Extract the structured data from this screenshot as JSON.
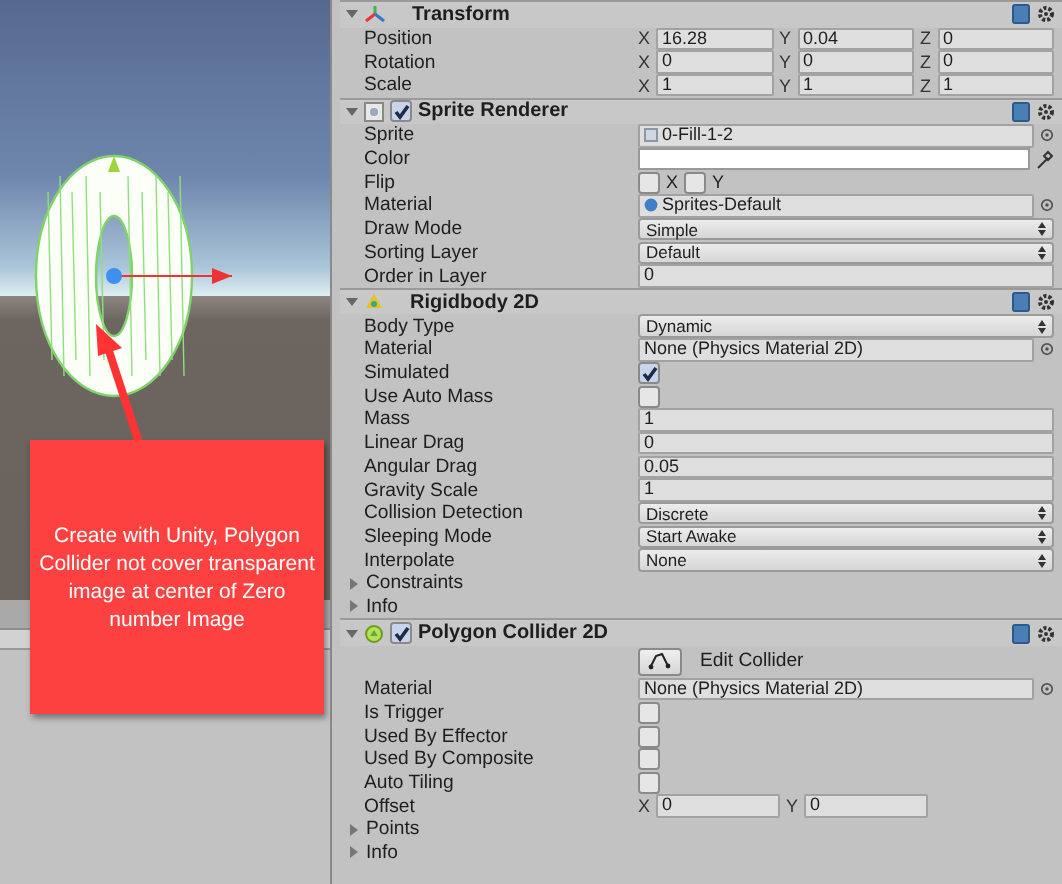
{
  "scene": {
    "annotation": "Create with Unity, Polygon Collider not cover transparent image at center of Zero number Image"
  },
  "components": [
    {
      "kind": "transform",
      "title": "Transform",
      "expanded": true,
      "rows": [
        {
          "kind": "vector",
          "label": "Position",
          "axes": [
            {
              "axis": "X",
              "value": "16.28"
            },
            {
              "axis": "Y",
              "value": "0.04"
            },
            {
              "axis": "Z",
              "value": "0"
            }
          ]
        },
        {
          "kind": "vector",
          "label": "Rotation",
          "axes": [
            {
              "axis": "X",
              "value": "0"
            },
            {
              "axis": "Y",
              "value": "0"
            },
            {
              "axis": "Z",
              "value": "0"
            }
          ]
        },
        {
          "kind": "vector",
          "label": "Scale",
          "axes": [
            {
              "axis": "X",
              "value": "1"
            },
            {
              "axis": "Y",
              "value": "1"
            },
            {
              "axis": "Z",
              "value": "1"
            }
          ]
        }
      ]
    },
    {
      "kind": "sprite",
      "title": "Sprite Renderer",
      "expanded": true,
      "enabled": true,
      "rows": [
        {
          "kind": "sprite",
          "label": "Sprite",
          "value": "0-Fill-1-2"
        },
        {
          "kind": "color",
          "label": "Color"
        },
        {
          "kind": "flip",
          "label": "Flip",
          "options": [
            {
              "label": "X",
              "checked": false
            },
            {
              "label": "Y",
              "checked": false
            }
          ]
        },
        {
          "kind": "material",
          "label": "Material",
          "value": "Sprites-Default"
        },
        {
          "kind": "dropdown",
          "label": "Draw Mode",
          "value": "Simple"
        },
        {
          "kind": "dropdown",
          "label": "Sorting Layer",
          "value": "Default"
        },
        {
          "kind": "text",
          "label": "Order in Layer",
          "value": "0"
        }
      ]
    },
    {
      "kind": "rigidbody",
      "title": "Rigidbody 2D",
      "expanded": true,
      "rows": [
        {
          "kind": "dropdown",
          "label": "Body Type",
          "value": "Dynamic"
        },
        {
          "kind": "object",
          "label": "Material",
          "value": "None (Physics Material 2D)"
        },
        {
          "kind": "checkbox",
          "label": "Simulated",
          "checked": true
        },
        {
          "kind": "checkbox",
          "label": "Use Auto Mass",
          "checked": false
        },
        {
          "kind": "text",
          "label": "Mass",
          "value": "1"
        },
        {
          "kind": "text",
          "label": "Linear Drag",
          "value": "0"
        },
        {
          "kind": "text",
          "label": "Angular Drag",
          "value": "0.05"
        },
        {
          "kind": "text",
          "label": "Gravity Scale",
          "value": "1"
        },
        {
          "kind": "dropdown",
          "label": "Collision Detection",
          "value": "Discrete"
        },
        {
          "kind": "dropdown",
          "label": "Sleeping Mode",
          "value": "Start Awake"
        },
        {
          "kind": "dropdown",
          "label": "Interpolate",
          "value": "None"
        },
        {
          "kind": "foldout",
          "label": "Constraints",
          "expanded": false
        },
        {
          "kind": "foldout",
          "label": "Info",
          "expanded": false
        }
      ]
    },
    {
      "kind": "collider",
      "title": "Polygon Collider 2D",
      "expanded": true,
      "enabled": true,
      "rows": [
        {
          "kind": "button",
          "label": "Edit Collider"
        },
        {
          "kind": "object",
          "label": "Material",
          "value": "None (Physics Material 2D)"
        },
        {
          "kind": "checkbox",
          "label": "Is Trigger",
          "checked": false
        },
        {
          "kind": "checkbox",
          "label": "Used By Effector",
          "checked": false
        },
        {
          "kind": "checkbox",
          "label": "Used By Composite",
          "checked": false
        },
        {
          "kind": "checkbox",
          "label": "Auto Tiling",
          "checked": false
        },
        {
          "kind": "vector",
          "label": "Offset",
          "axes": [
            {
              "axis": "X",
              "value": "0"
            },
            {
              "axis": "Y",
              "value": "0"
            }
          ]
        },
        {
          "kind": "foldout",
          "label": "Points",
          "expanded": false
        },
        {
          "kind": "foldout",
          "label": "Info",
          "expanded": false
        }
      ]
    }
  ]
}
